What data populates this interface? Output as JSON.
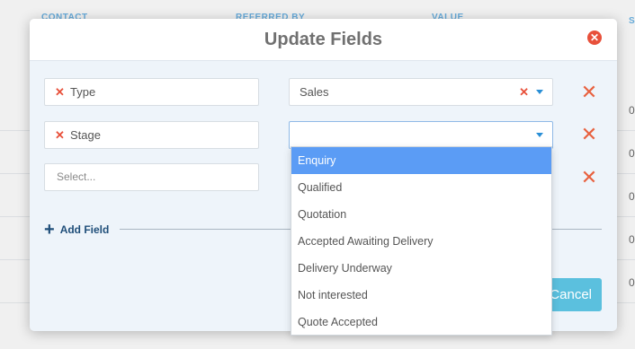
{
  "background": {
    "columns": [
      "CONTACT",
      "REFERRED BY",
      "VALUE",
      "S"
    ],
    "row_values": [
      "0",
      "0",
      "0",
      "0",
      "0"
    ]
  },
  "modal": {
    "title": "Update Fields",
    "close_icon": "close-circle-icon",
    "rows": [
      {
        "field": "Type",
        "value": "Sales",
        "value_placeholder": ""
      },
      {
        "field": "Stage",
        "value": "",
        "value_placeholder": ""
      },
      {
        "field": "",
        "field_placeholder": "Select..."
      }
    ],
    "add_field_label": "Add Field",
    "cancel_label": "Cancel"
  },
  "stage_dropdown": {
    "options": [
      "Enquiry",
      "Qualified",
      "Quotation",
      "Accepted Awaiting Delivery",
      "Delivery Underway",
      "Not interested",
      "Quote Accepted"
    ],
    "highlighted": "Enquiry"
  },
  "colors": {
    "accent": "#5bc0de",
    "danger": "#e8503a",
    "highlight": "#5b9cf5",
    "link": "#1f4e79"
  }
}
